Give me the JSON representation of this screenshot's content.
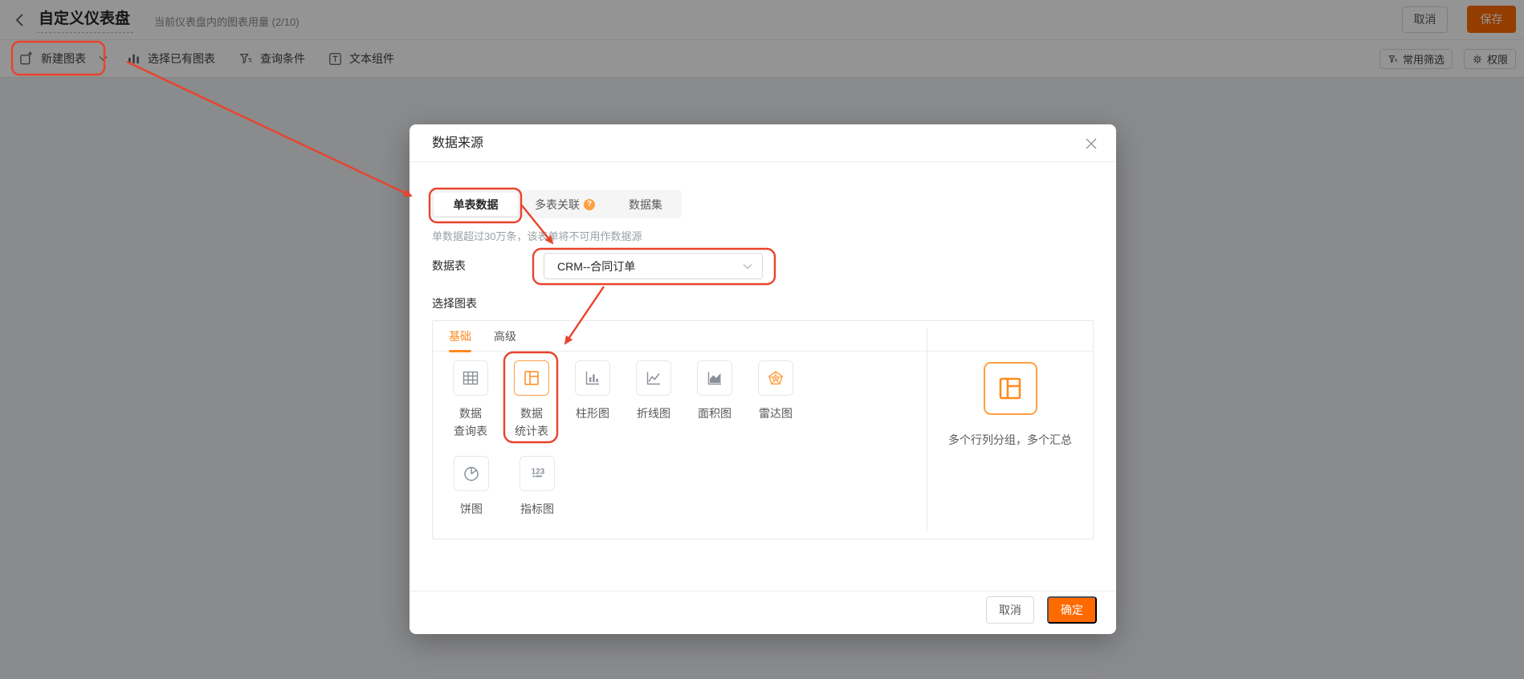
{
  "colors": {
    "accent": "#ff6a00",
    "accent_mid": "#ff8a1e",
    "accent_light": "#ffa040",
    "annotation": "#e8432c",
    "icon_grey": "#8a9099"
  },
  "header": {
    "title": "自定义仪表盘",
    "usage": "当前仪表盘内的图表用量 (2/10)",
    "cancel": "取消",
    "save": "保存"
  },
  "toolbar": {
    "new_chart": "新建图表",
    "select_existing": "选择已有图表",
    "query_condition": "查询条件",
    "text_widget": "文本组件",
    "common_filter": "常用筛选",
    "permission": "权限"
  },
  "modal": {
    "title": "数据来源",
    "tabs": [
      {
        "label": "单表数据",
        "active": true
      },
      {
        "label": "多表关联",
        "badge": "?"
      },
      {
        "label": "数据集"
      }
    ],
    "helper": "单数据超过30万条，该表单将不可用作数据源",
    "form": {
      "label": "数据表",
      "value": "CRM--合同订单"
    },
    "choose_chart_label": "选择图表",
    "level_tabs": [
      {
        "label": "基础",
        "active": true
      },
      {
        "label": "高级"
      }
    ],
    "chart_types": [
      {
        "line1": "数据",
        "line2": "查询表",
        "icon": "table-icon"
      },
      {
        "line1": "数据",
        "line2": "统计表",
        "icon": "stats-table-icon",
        "selected": true
      },
      {
        "line1": "柱形图",
        "icon": "bar-chart-icon"
      },
      {
        "line1": "折线图",
        "icon": "line-chart-icon"
      },
      {
        "line1": "面积图",
        "icon": "area-chart-icon"
      },
      {
        "line1": "雷达图",
        "icon": "radar-chart-icon"
      },
      {
        "line1": "饼图",
        "icon": "pie-chart-icon"
      },
      {
        "line1": "指标图",
        "icon": "metric-icon",
        "icon_text": "123"
      }
    ],
    "preview_caption": "多个行列分组，多个汇总",
    "footer": {
      "cancel": "取消",
      "ok": "确定"
    }
  }
}
